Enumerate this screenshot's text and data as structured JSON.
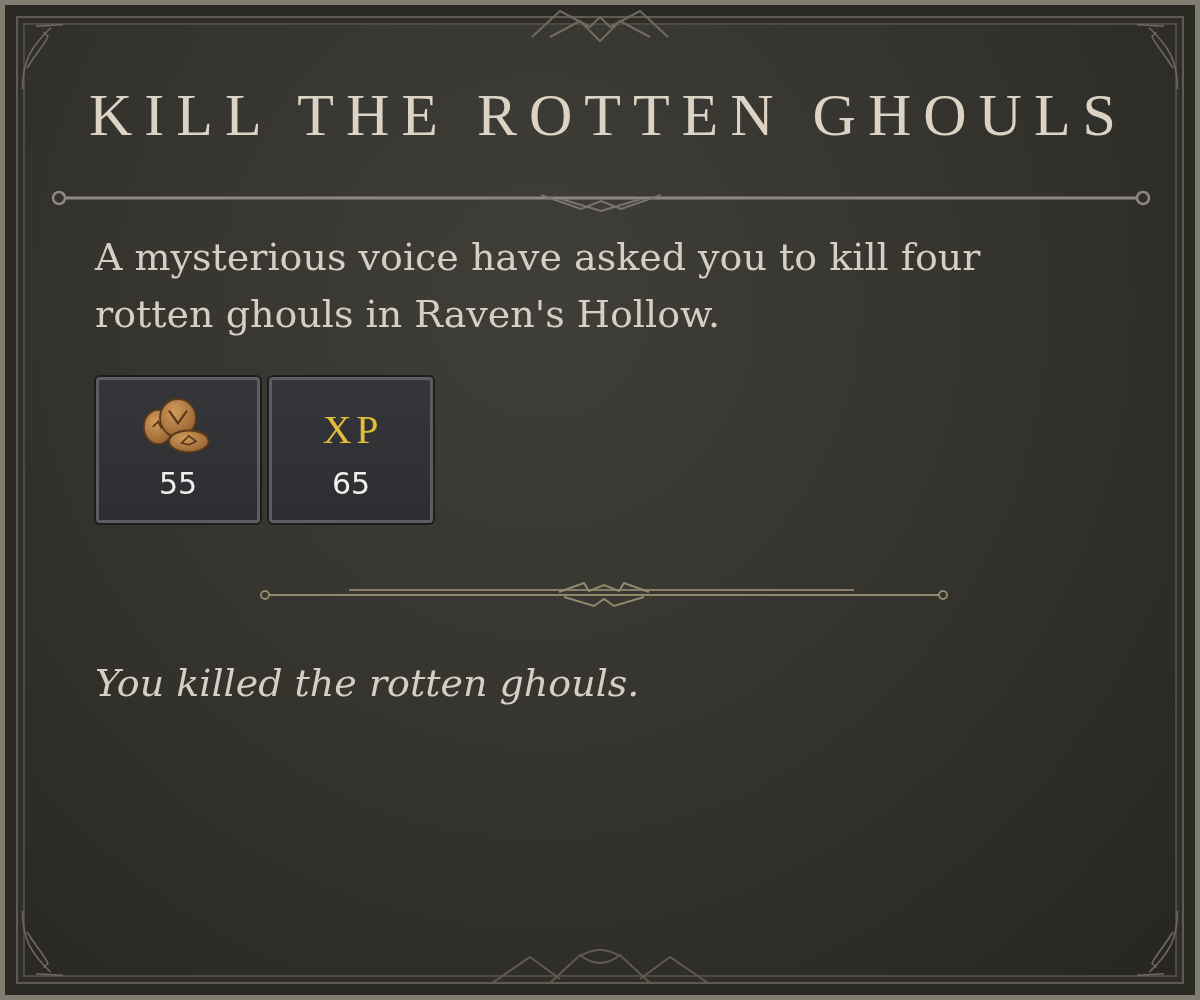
{
  "panel": {
    "title": "KILL THE ROTTEN GHOULS",
    "description": "A mysterious voice have asked you to kill four rotten ghouls in Raven's Hollow.",
    "rewards": [
      {
        "kind": "coins",
        "amount": "55"
      },
      {
        "kind": "xp",
        "label": "XP",
        "amount": "65"
      }
    ],
    "status": "You killed the rotten ghouls."
  }
}
